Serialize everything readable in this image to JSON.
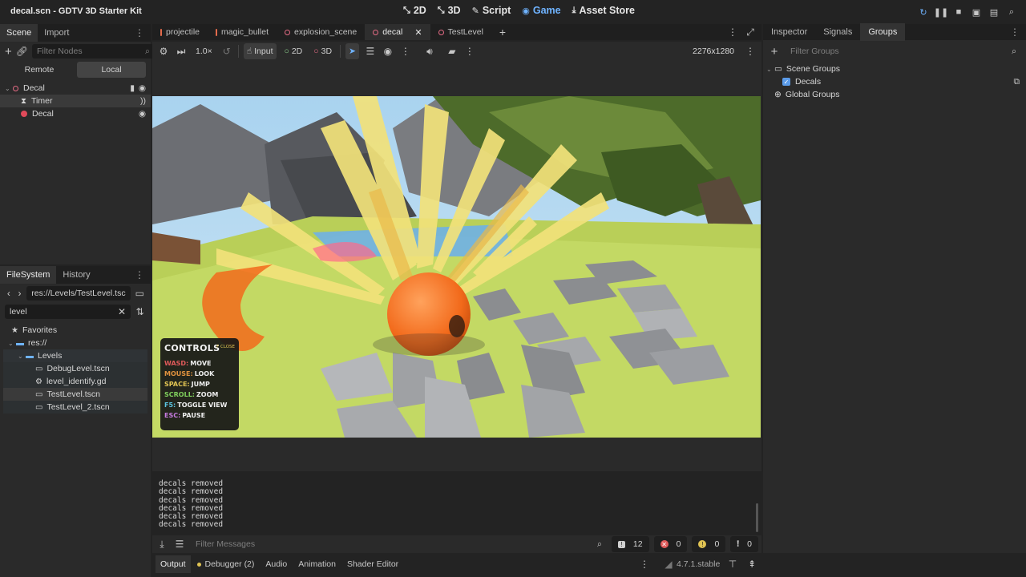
{
  "window": {
    "title": "decal.scn - GDTV 3D Starter Kit"
  },
  "modes": [
    {
      "label": "2D",
      "icon": "2d-icon",
      "glyph": "⤡"
    },
    {
      "label": "3D",
      "icon": "3d-icon",
      "glyph": "⤡"
    },
    {
      "label": "Script",
      "icon": "script-icon",
      "glyph": "✎"
    },
    {
      "label": "Game",
      "icon": "gamepad-icon",
      "glyph": "◉",
      "active": true
    },
    {
      "label": "Asset Store",
      "icon": "asset-store-icon",
      "glyph": "⤓"
    }
  ],
  "scene_panel": {
    "tabs": [
      "Scene",
      "Import"
    ],
    "filter_placeholder": "Filter Nodes",
    "remote_label": "Remote",
    "local_label": "Local",
    "tree": [
      {
        "label": "Decal",
        "depth": 0,
        "icon": "decal-icon",
        "selected": false
      },
      {
        "label": "Timer",
        "depth": 1,
        "icon": "timer-icon",
        "selected": true
      },
      {
        "label": "Decal",
        "depth": 1,
        "icon": "decal-node-icon",
        "selected": false
      }
    ]
  },
  "filesystem": {
    "tabs": [
      "FileSystem",
      "History"
    ],
    "path": "res://Levels/TestLevel.tsc",
    "search_value": "level",
    "tree": [
      {
        "label": "Favorites",
        "depth": 0,
        "icon": "star-icon"
      },
      {
        "label": "res://",
        "depth": 0,
        "icon": "folder-icon"
      },
      {
        "label": "Levels",
        "depth": 1,
        "icon": "folder-icon"
      },
      {
        "label": "DebugLevel.tscn",
        "depth": 2,
        "icon": "scene-file-icon"
      },
      {
        "label": "level_identify.gd",
        "depth": 2,
        "icon": "gear-icon"
      },
      {
        "label": "TestLevel.tscn",
        "depth": 2,
        "icon": "scene-file-icon",
        "selected": true
      },
      {
        "label": "TestLevel_2.tscn",
        "depth": 2,
        "icon": "scene-file-icon"
      }
    ]
  },
  "doc_tabs": [
    {
      "label": "projectile",
      "color": "#e36b4c"
    },
    {
      "label": "magic_bullet",
      "color": "#e36b4c"
    },
    {
      "label": "explosion_scene",
      "color": "#e36b84"
    },
    {
      "label": "decal",
      "color": "#e36b84",
      "active": true
    },
    {
      "label": "TestLevel",
      "color": "#e36b84"
    }
  ],
  "viewport_toolbar": {
    "speed": "1.0×",
    "input_label": "Input",
    "label_2d": "2D",
    "label_3d": "3D",
    "resolution": "2276x1280"
  },
  "controls_overlay": {
    "title": "CONTROLS",
    "close_hint": "F CLOSE",
    "rows": [
      {
        "key": "WASD:",
        "action": "MOVE",
        "color": "#e05a5a"
      },
      {
        "key": "MOUSE:",
        "action": "LOOK",
        "color": "#e0923e"
      },
      {
        "key": "SPACE:",
        "action": "JUMP",
        "color": "#e1c453"
      },
      {
        "key": "SCROLL:",
        "action": "ZOOM",
        "color": "#7fcf5c"
      },
      {
        "key": "F5:",
        "action": "TOGGLE VIEW",
        "color": "#5cc4e0"
      },
      {
        "key": "ESC:",
        "action": "PAUSE",
        "color": "#c77be0"
      }
    ]
  },
  "output": {
    "lines": [
      "decals removed",
      "decals removed",
      "decals removed",
      "decals removed",
      "decals removed",
      "decals removed"
    ],
    "filter_placeholder": "Filter Messages",
    "counts": {
      "messages": "12",
      "errors": "0",
      "warnings": "0",
      "info": "0"
    }
  },
  "bottom_tabs": [
    "Output",
    "Debugger (2)",
    "Audio",
    "Animation",
    "Shader Editor"
  ],
  "version": "4.7.1.stable",
  "right_panel": {
    "tabs": [
      "Inspector",
      "Signals",
      "Groups"
    ],
    "filter_placeholder": "Filter Groups",
    "scene_groups_label": "Scene Groups",
    "group_decals": "Decals",
    "global_groups_label": "Global Groups"
  },
  "colors": {
    "accent": "#6fb3ff",
    "panel": "#2a2a2a",
    "error": "#e05a5a",
    "warning": "#e1c453"
  }
}
